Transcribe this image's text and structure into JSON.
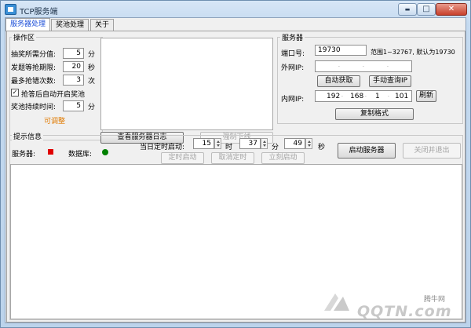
{
  "window": {
    "title": "TCP服务端",
    "minimize_icon": "minimize-icon",
    "maximize_icon": "maximize-icon",
    "close_icon": "close-icon",
    "min_glyph": "▬",
    "max_glyph": "□",
    "close_glyph": "✕"
  },
  "tabs": [
    "服务器处理",
    "奖池处理",
    "关于"
  ],
  "ops": {
    "title": "操作区",
    "score_label": "抽奖所需分值:",
    "score_value": "5",
    "score_unit": "分",
    "timeout_label": "发题等抢期限:",
    "timeout_value": "20",
    "timeout_unit": "秒",
    "max_wrong_label": "最多抢错次数:",
    "max_wrong_value": "3",
    "max_wrong_unit": "次",
    "auto_pool_label": "抢答后自动开启奖池",
    "auto_pool_checked": true,
    "duration_label": "奖池持续时间:",
    "duration_value": "5",
    "duration_unit": "分",
    "adjustable_note": "可调整",
    "view_log_button": "查看服务器日志",
    "force_offline_button": "强制下线"
  },
  "server": {
    "title": "服务器",
    "port_label": "端口号:",
    "port_value": "19730",
    "port_hint": "范围1~32767, 默认为19730",
    "wan_label": "外网IP:",
    "wan_ip": [
      "",
      "",
      "",
      ""
    ],
    "auto_get_button": "自动获取",
    "manual_query_button": "手动查询IP",
    "lan_label": "内网IP:",
    "lan_ip": [
      "192",
      "168",
      "1",
      "101"
    ],
    "refresh_button": "刷新",
    "copy_format_button": "复制格式"
  },
  "info": {
    "title": "提示信息",
    "server_label": "服务器:",
    "server_status_color": "#e00000",
    "db_label": "数据库:",
    "db_status_color": "#008000",
    "timer_label": "当日定时启动:",
    "hour": "15",
    "hour_unit": "时",
    "minute": "37",
    "minute_unit": "分",
    "second": "49",
    "second_unit": "秒",
    "timed_start_button": "定时启动",
    "cancel_timer_button": "取消定时",
    "start_now_button": "立刻启动",
    "start_server_button": "启动服务器",
    "close_exit_button": "关闭并退出"
  },
  "watermark": {
    "site": "腾牛网",
    "logo": "QQTN.com"
  }
}
